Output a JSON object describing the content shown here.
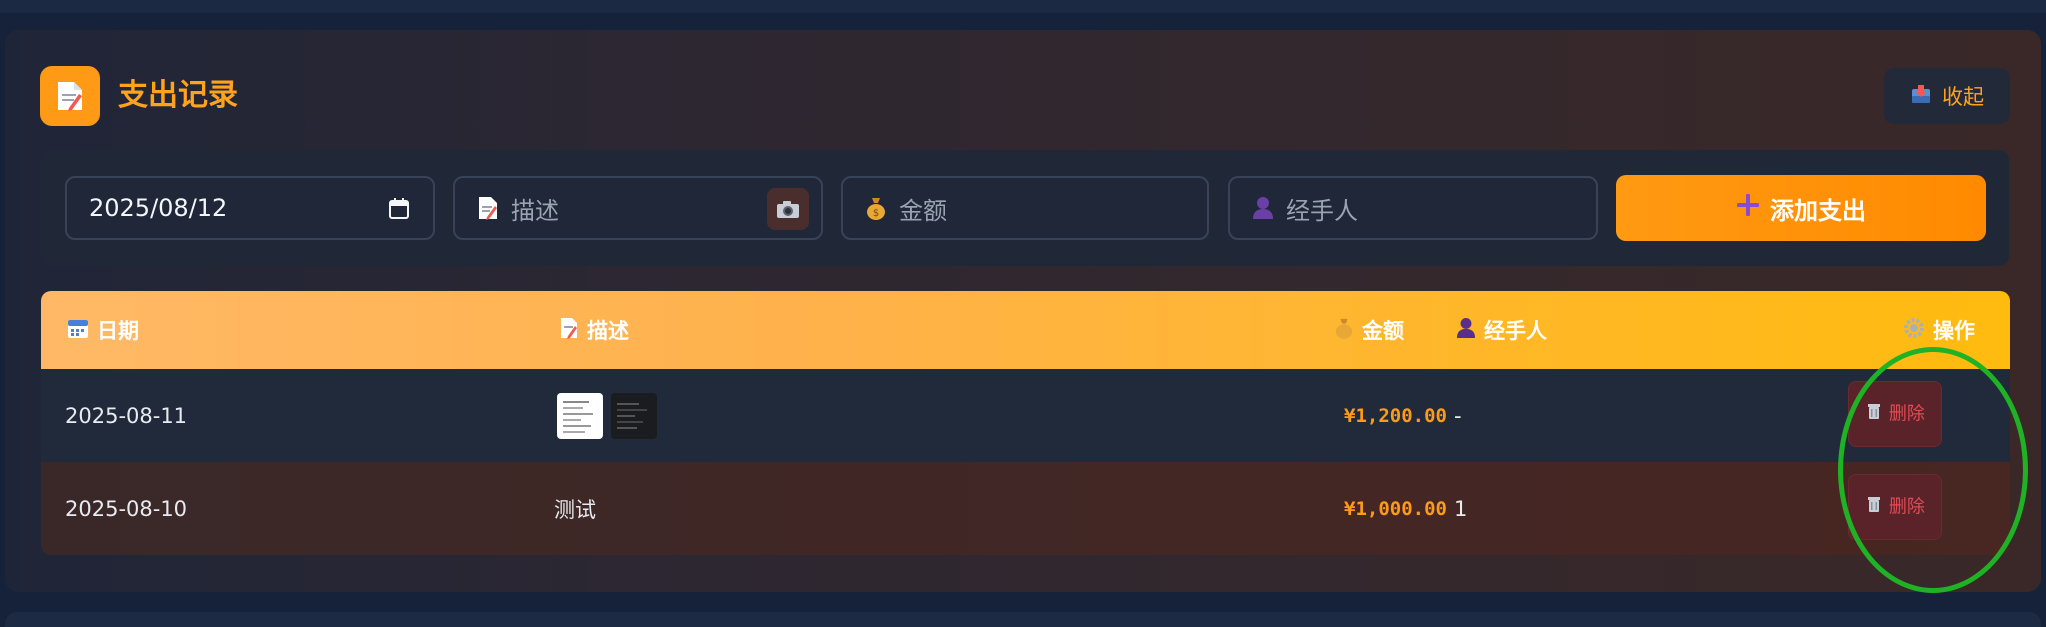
{
  "section": {
    "title": "支出记录",
    "collapse_label": "收起"
  },
  "form": {
    "date_value": "2025/08/12",
    "description_placeholder": "描述",
    "amount_placeholder": "金额",
    "handler_placeholder": "经手人",
    "add_button_label": "添加支出"
  },
  "table": {
    "headers": {
      "date": "日期",
      "description": "描述",
      "amount": "金额",
      "handler": "经手人",
      "actions": "操作"
    },
    "rows": [
      {
        "date": "2025-08-11",
        "description": "",
        "has_images": true,
        "amount": "¥1,200.00",
        "handler": "-",
        "delete_label": "删除"
      },
      {
        "date": "2025-08-10",
        "description": "测试",
        "has_images": false,
        "amount": "¥1,000.00",
        "handler": "1",
        "delete_label": "删除"
      }
    ]
  },
  "icons": {
    "header": "memo-icon",
    "collapse": "inbox-tray-icon",
    "calendar": "calendar-icon",
    "camera": "camera-icon",
    "money_bag": "money-bag-icon",
    "person": "person-icon",
    "plus": "plus-icon",
    "gear": "gear-icon",
    "trash": "trash-icon"
  },
  "colors": {
    "accent": "#ff9a16",
    "danger": "#e04b54",
    "highlight_ring": "#1fb224"
  }
}
